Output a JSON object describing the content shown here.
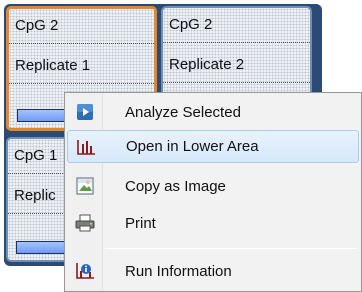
{
  "tiles": [
    {
      "title": "CpG 2",
      "replicate": "Replicate 1",
      "selected": true
    },
    {
      "title": "CpG 2",
      "replicate": "Replicate 2",
      "selected": false
    },
    {
      "title": "CpG 1",
      "replicate": "Replic",
      "selected": false
    }
  ],
  "context_menu": {
    "items": [
      {
        "label": "Analyze Selected",
        "icon": "play-icon"
      },
      {
        "label": "Open in Lower Area",
        "icon": "bar-chart-icon",
        "highlighted": true
      },
      {
        "label": "Copy as Image",
        "icon": "image-icon"
      },
      {
        "label": "Print",
        "icon": "printer-icon"
      },
      {
        "label": "Run Information",
        "icon": "run-info-icon"
      }
    ]
  },
  "colors": {
    "grid_background": "#2b4a75",
    "selected_border": "#e4872a",
    "menu_highlight": "#d6e8fb"
  }
}
